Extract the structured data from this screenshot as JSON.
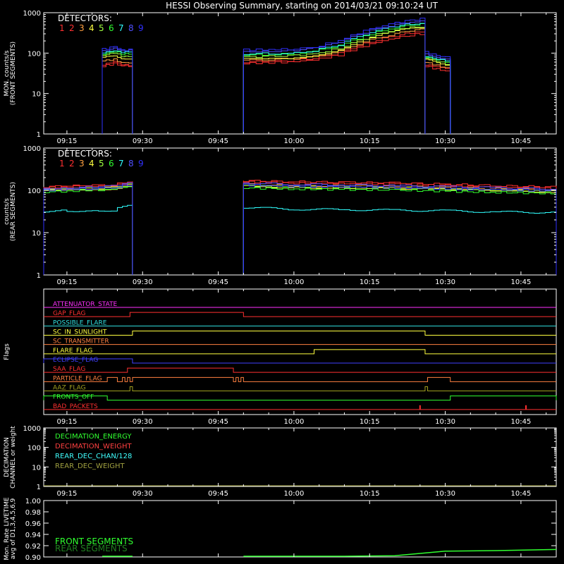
{
  "chart_data": {
    "type": "line",
    "title": "HESSI Observing Summary, starting on 2014/03/21 09:10:24 UT",
    "x_tick_labels": [
      "09:15",
      "09:30",
      "09:45",
      "10:00",
      "10:15",
      "10:30",
      "10:45"
    ],
    "x_ticks_ut": [
      "09:15",
      "09:30",
      "09:45",
      "10:00",
      "10:15",
      "10:30",
      "10:45"
    ],
    "x_range": [
      "09:10:24",
      "10:52:00"
    ],
    "detectors_label": "DETECTORS:",
    "detector_numbers": [
      "1",
      "2",
      "3",
      "4",
      "5",
      "6",
      "7",
      "8",
      "9"
    ],
    "detector_colors": [
      "#ff3030",
      "#ff3030",
      "#ffa040",
      "#ffff40",
      "#a0ff40",
      "#30ff30",
      "#30ffff",
      "#5050ff",
      "#3030ff"
    ],
    "panels": {
      "front": {
        "ylabel": "MON. counts/s",
        "ylabel2": "(FRONT SEGMENTS)",
        "yscale": "log",
        "ylim": [
          1,
          1000
        ],
        "ytick_labels": [
          "1000",
          "100",
          "10",
          "1"
        ],
        "intervals": [
          {
            "start": "09:22:00",
            "end": "09:28:00",
            "t": [
              "09:22:00",
              "09:23:30",
              "09:25:00",
              "09:26:30",
              "09:28:00"
            ],
            "v": [
              [
                50,
                55,
                60,
                50
              ],
              [
                45,
                50,
                55,
                48
              ],
              [
                60,
                65,
                70,
                60
              ],
              [
                70,
                80,
                85,
                75
              ],
              [
                80,
                90,
                100,
                85
              ],
              [
                90,
                100,
                110,
                95
              ],
              [
                100,
                110,
                120,
                105
              ],
              [
                110,
                120,
                140,
                115
              ],
              [
                120,
                130,
                150,
                120
              ]
            ]
          },
          {
            "start": "09:50:00",
            "end": "10:26:00",
            "t": [
              "09:50:00",
              "09:55:00",
              "10:00:00",
              "10:05:00",
              "10:10:00",
              "10:15:00",
              "10:20:00",
              "10:23:00",
              "10:26:00"
            ],
            "v": [
              [
                60,
                62,
                65,
                75,
                100,
                170,
                250,
                300,
                330
              ],
              [
                55,
                58,
                60,
                68,
                90,
                150,
                220,
                270,
                300
              ],
              [
                65,
                68,
                72,
                82,
                110,
                190,
                280,
                340,
                380
              ],
              [
                70,
                72,
                75,
                88,
                120,
                210,
                320,
                390,
                420
              ],
              [
                80,
                82,
                85,
                95,
                130,
                230,
                350,
                420,
                450
              ],
              [
                90,
                92,
                95,
                110,
                150,
                260,
                400,
                480,
                510
              ],
              [
                95,
                98,
                100,
                115,
                160,
                280,
                430,
                520,
                560
              ],
              [
                110,
                112,
                115,
                130,
                180,
                320,
                480,
                580,
                640
              ],
              [
                120,
                122,
                125,
                140,
                200,
                350,
                520,
                620,
                700
              ]
            ]
          },
          {
            "start": "10:26:00",
            "end": "10:31:00",
            "t": [
              "10:26:00",
              "10:27:30",
              "10:29:00",
              "10:31:00"
            ],
            "v": [
              [
                55,
                50,
                45,
                40
              ],
              [
                50,
                45,
                40,
                36
              ],
              [
                60,
                55,
                50,
                45
              ],
              [
                70,
                65,
                58,
                52
              ],
              [
                75,
                70,
                62,
                55
              ],
              [
                85,
                78,
                70,
                62
              ],
              [
                90,
                82,
                74,
                66
              ],
              [
                100,
                92,
                82,
                72
              ],
              [
                110,
                100,
                90,
                80
              ]
            ]
          }
        ]
      },
      "rear": {
        "ylabel": "counts/s",
        "ylabel2": "(REAR SEGMENTS)",
        "yscale": "log",
        "ylim": [
          1,
          1000
        ],
        "ytick_labels": [
          "1000",
          "100",
          "10",
          "1"
        ],
        "intervals": [
          {
            "start": "09:10:24",
            "end": "09:28:00",
            "t": [
              "09:10:24",
              "09:15:00",
              "09:20:00",
              "09:25:00",
              "09:28:00"
            ],
            "v": [
              [
                120,
                125,
                130,
                135,
                160
              ],
              [
                115,
                120,
                125,
                130,
                150
              ],
              [
                105,
                108,
                112,
                118,
                140
              ],
              [
                95,
                100,
                105,
                110,
                130
              ],
              [
                100,
                105,
                110,
                115,
                135
              ],
              [
                90,
                95,
                100,
                105,
                125
              ],
              [
                32,
                33,
                33,
                34,
                45
              ],
              [
                110,
                115,
                120,
                125,
                145
              ],
              [
                100,
                105,
                110,
                115,
                135
              ]
            ]
          },
          {
            "start": "09:50:00",
            "end": "10:52:00",
            "t": [
              "09:50:00",
              "10:00:00",
              "10:10:00",
              "10:20:00",
              "10:30:00",
              "10:40:00",
              "10:52:00"
            ],
            "v": [
              [
                170,
                160,
                155,
                150,
                140,
                130,
                120
              ],
              [
                160,
                150,
                145,
                140,
                130,
                120,
                110
              ],
              [
                140,
                130,
                128,
                125,
                118,
                110,
                100
              ],
              [
                125,
                118,
                115,
                112,
                105,
                98,
                92
              ],
              [
                130,
                122,
                118,
                115,
                108,
                100,
                95
              ],
              [
                115,
                108,
                105,
                102,
                96,
                90,
                85
              ],
              [
                40,
                36,
                35,
                34,
                33,
                31,
                30
              ],
              [
                150,
                140,
                135,
                130,
                122,
                115,
                108
              ],
              [
                135,
                126,
                122,
                118,
                110,
                104,
                98
              ]
            ]
          }
        ]
      },
      "flags": {
        "ylabel": "Flags",
        "rows": [
          {
            "name": "ATTENUATOR_STATE",
            "color": "#ff30ff",
            "high": []
          },
          {
            "name": "GAP_FLAG",
            "color": "#ff3030",
            "high": [
              [
                "09:27:30",
                "09:50:00"
              ]
            ]
          },
          {
            "name": "POSSIBLE_FLARE",
            "color": "#30e0e0",
            "high": []
          },
          {
            "name": "SC_IN_SUNLIGHT",
            "color": "#ffff40",
            "high": [
              [
                "09:28:00",
                "10:26:00"
              ]
            ]
          },
          {
            "name": "SC_TRANSMITTER",
            "color": "#ff8040",
            "high": []
          },
          {
            "name": "FLARE_FLAG",
            "color": "#ffff40",
            "high": [
              [
                "10:04:00",
                "10:26:00"
              ]
            ]
          },
          {
            "name": "ECLIPSE_FLAG",
            "color": "#4040ff",
            "high": [
              [
                "09:10:24",
                "09:28:00"
              ]
            ]
          },
          {
            "name": "SAA_FLAG",
            "color": "#ff3030",
            "high": [
              [
                "09:27:00",
                "09:48:00"
              ]
            ]
          },
          {
            "name": "PARTICLE_FLAG",
            "color": "#ff8040",
            "high": [
              [
                "09:23:00",
                "09:25:00"
              ],
              [
                "09:26:00",
                "09:26:30"
              ],
              [
                "09:27:00",
                "09:27:30"
              ],
              [
                "09:28:00",
                "09:48:00"
              ],
              [
                "09:48:30",
                "09:49:00"
              ],
              [
                "09:49:30",
                "09:50:00"
              ],
              [
                "10:26:30",
                "10:31:00"
              ]
            ]
          },
          {
            "name": "AAZ_FLAG",
            "color": "#a0a020",
            "high": [
              [
                "09:27:30",
                "09:28:00"
              ],
              [
                "10:26:00",
                "10:26:30"
              ]
            ]
          },
          {
            "name": "FRONTS_OFF",
            "color": "#30ff30",
            "high": [
              [
                "09:10:24",
                "09:23:00"
              ],
              [
                "10:31:00",
                "10:52:00"
              ]
            ]
          },
          {
            "name": "BAD_PACKETS",
            "color": "#ff3030",
            "high": [],
            "spikes": [
              "10:25:00",
              "10:46:00"
            ]
          }
        ]
      },
      "decimation": {
        "ylabel": "DECIMATION",
        "ylabel2": "CHANNEL or weight",
        "yscale": "log",
        "ylim": [
          1,
          1000
        ],
        "ytick_labels": [
          "1000",
          "100",
          "10",
          "1"
        ],
        "legend": [
          {
            "label": "DECIMATION_ENERGY",
            "color": "#30ff30"
          },
          {
            "label": "DECIMATION_WEIGHT",
            "color": "#ff4040"
          },
          {
            "label": "REAR_DEC_CHAN/128",
            "color": "#40ffff"
          },
          {
            "label": "REAR_DEC_WEIGHT",
            "color": "#a0a040"
          }
        ],
        "baseline_value": 1
      },
      "livetime": {
        "ylabel": "Mon. Rate LIVETIME",
        "ylabel2": "avg of D1,3,4,5,6,9",
        "ylim": [
          0.9,
          1.0
        ],
        "ytick_labels": [
          "1.00",
          "0.98",
          "0.96",
          "0.94",
          "0.92",
          "0.90"
        ],
        "legend": [
          {
            "label": "FRONT SEGMENTS",
            "color": "#30ff30"
          },
          {
            "label": "REAR SEGMENTS",
            "color": "#208020"
          }
        ],
        "series": [
          {
            "name": "FRONT SEGMENTS",
            "t": [
              "09:50:00",
              "10:00:00",
              "10:10:00",
              "10:20:00",
              "10:25:00",
              "10:30:00",
              "10:40:00",
              "10:52:00"
            ],
            "v": [
              0.9,
              0.9,
              0.9,
              0.901,
              0.905,
              0.909,
              0.91,
              0.912
            ]
          }
        ]
      }
    }
  }
}
